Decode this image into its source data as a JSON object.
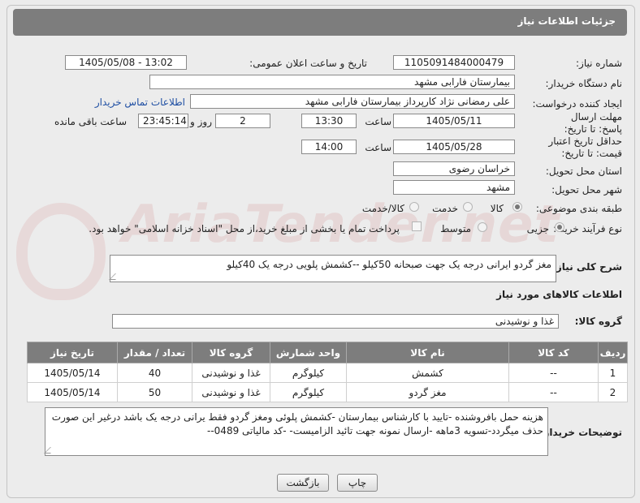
{
  "header": {
    "title": "جزئیات اطلاعات نیاز"
  },
  "form": {
    "need_number_label": "شماره نیاز:",
    "need_number": "1105091484000479",
    "announce_label": "تاریخ و ساعت اعلان عمومی:",
    "announce_value": "1405/05/08 - 13:02",
    "buyer_label": "نام دستگاه خریدار:",
    "buyer_value": "بیمارستان فارابی مشهد",
    "creator_label": "ایجاد کننده درخواست:",
    "creator_value": "علی رمضانی نژاد کارپرداز بیمارستان فارابی مشهد",
    "contact_link": "اطلاعات تماس خریدار",
    "deadline_label": "مهلت ارسال پاسخ: تا تاریخ:",
    "deadline_date": "1405/05/11",
    "time_word": "ساعت",
    "deadline_time": "13:30",
    "days_count": "2",
    "days_word": "روز و",
    "remaining_time": "23:45:14",
    "remaining_word": "ساعت باقی مانده",
    "min_price_label": "حداقل تاریخ اعتبار قیمت: تا تاریخ:",
    "min_price_date": "1405/05/28",
    "min_price_time": "14:00",
    "province_label": "استان محل تحویل:",
    "province_value": "خراسان رضوی",
    "city_label": "شهر محل تحویل:",
    "city_value": "مشهد",
    "category_label": "طبقه بندی موضوعی:",
    "category_options": [
      "کالا",
      "خدمت",
      "کالا/خدمت"
    ],
    "category_selected": "کالا",
    "process_label": "نوع فرآیند خرید :",
    "process_options": [
      "جزیی",
      "متوسط"
    ],
    "process_selected": "جزیی",
    "payment_note": "پرداخت تمام یا بخشی از مبلغ خرید،از محل \"اسناد خزانه اسلامی\" خواهد بود."
  },
  "summary": {
    "label": "شرح کلی نیاز:",
    "value": "مغز گردو ایرانی درجه یک جهت صبحانه 50کیلو --کشمش پلویی درجه یک 40کیلو"
  },
  "goods": {
    "section_title": "اطلاعات کالاهای مورد نیاز",
    "group_label": "گروه کالا:",
    "group_value": "غذا و نوشیدنی"
  },
  "table": {
    "headers": [
      "ردیف",
      "کد کالا",
      "نام کالا",
      "واحد شمارش",
      "گروه کالا",
      "تعداد / مقدار",
      "تاریخ نیاز"
    ],
    "rows": [
      [
        "1",
        "--",
        "کشمش",
        "کیلوگرم",
        "غذا و نوشیدنی",
        "40",
        "1405/05/14"
      ],
      [
        "2",
        "--",
        "مغز گردو",
        "کیلوگرم",
        "غذا و نوشیدنی",
        "50",
        "1405/05/14"
      ]
    ]
  },
  "buyer_notes": {
    "label": "توضیحات خریدار:",
    "value": "هزینه حمل بافروشنده -تایید با کارشناس بیمارستان -کشمش پلوئی ومغز گردو فقط یرانی درجه یک باشد درغیر این صورت حذف میگردد-تسویه 3ماهه -ارسال نمونه جهت تائید الزامیست- -کد مالیاتی 0489--"
  },
  "buttons": {
    "print": "چاپ",
    "back": "بازگشت"
  },
  "watermark": {
    "text": "AriaTender.net"
  },
  "colors": {
    "header_bg": "#7d7d7d",
    "link": "#1f4fa3",
    "page_bg": "#ececec"
  }
}
